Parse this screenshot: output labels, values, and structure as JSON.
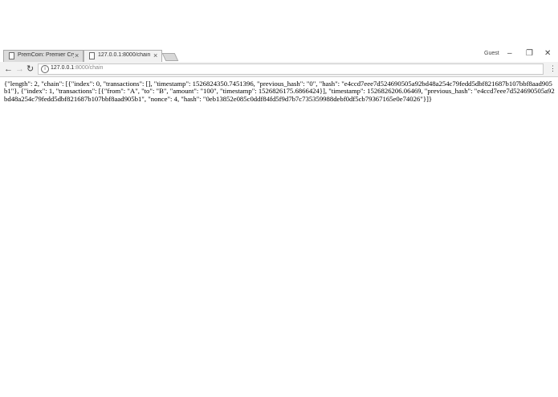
{
  "tabs": [
    {
      "title": "PremCoin: Premier Cryp",
      "close": "×"
    },
    {
      "title": "127.0.0.1:8000/chain",
      "close": "×"
    }
  ],
  "window": {
    "user": "Guest",
    "minimize": "–",
    "restore": "❐",
    "close": "✕"
  },
  "nav": {
    "back": "←",
    "forward": "→",
    "reload": "↻",
    "menu": "⋮"
  },
  "address": {
    "info": "i",
    "host": "127.0.0.1",
    "path": ":8000/chain"
  },
  "content": {
    "json_text": "{\"length\": 2, \"chain\": [{\"index\": 0, \"transactions\": [], \"timestamp\": 1526824350.7451396, \"previous_hash\": \"0\", \"hash\": \"e4ccd7eee7d524690505a92bd48a254c79fedd5dbf821687b107bbf8aad905b1\"}, {\"index\": 1, \"transactions\": [{\"from\": \"A\", \"to\": \"B\", \"amount\": \"100\", \"timestamp\": 1526826175.6866424}], \"timestamp\": 1526826206.06469, \"previous_hash\": \"e4ccd7eee7d524690505a92bd48a254c79fedd5dbf821687b107bbf8aad905b1\", \"nonce\": 4, \"hash\": \"0eb13852e085c0ddf84fd5f9d7b7c735359988debf0df5cb79367165e0e74026\"}]}"
  },
  "colors": {
    "tab_inactive": "#dcdcdc",
    "tab_active": "#f2f2f2",
    "toolbar": "#f2f2f2",
    "page_bg": "#ffffff"
  }
}
